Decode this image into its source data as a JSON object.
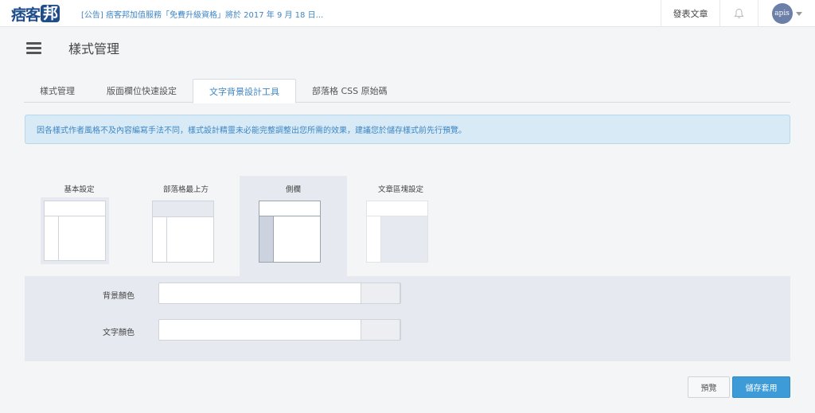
{
  "topbar": {
    "logo_main": "痞客",
    "logo_bubble": "邦",
    "announcement": "[公告] 痞客邦加值服務「免費升級資格」將於 2017 年 9 月 18 日...",
    "publish_label": "發表文章",
    "bell_icon": "bell-icon",
    "avatar_text": "apis"
  },
  "header": {
    "title": "樣式管理"
  },
  "tabs": [
    {
      "label": "樣式管理",
      "active": false
    },
    {
      "label": "版面欄位快速設定",
      "active": false
    },
    {
      "label": "文字背景設計工具",
      "active": true
    },
    {
      "label": "部落格 CSS 原始碼",
      "active": false
    }
  ],
  "notice": "因各樣式作者風格不及內容編寫手法不同，樣式設計精靈未必能完整調整出您所需的效果，建議您於儲存樣式前先行預覽。",
  "layout_options": [
    {
      "label": "基本設定",
      "selected": false
    },
    {
      "label": "部落格最上方",
      "selected": false
    },
    {
      "label": "側欄",
      "selected": true
    },
    {
      "label": "文章區塊設定",
      "selected": false
    }
  ],
  "colors": {
    "background_label": "背景顏色",
    "background_value": "",
    "text_label": "文字顏色",
    "text_value": ""
  },
  "buttons": {
    "preview": "預覽",
    "save": "儲存套用"
  },
  "theme": {
    "accent": "#3d9bd8",
    "link": "#3f86c4",
    "logo": "#1f4d8c"
  }
}
